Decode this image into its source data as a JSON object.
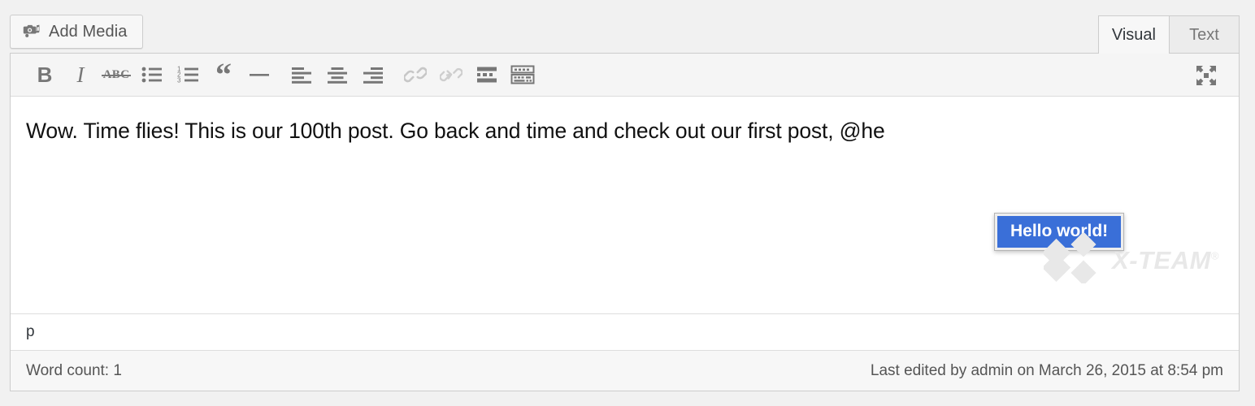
{
  "toolbar_top": {
    "add_media_label": "Add Media",
    "add_media_icon": "camera-music-icon",
    "tabs": [
      {
        "label": "Visual",
        "active": true
      },
      {
        "label": "Text",
        "active": false
      }
    ]
  },
  "format_toolbar": {
    "buttons": [
      {
        "name": "bold",
        "glyph": "B",
        "title": "Bold",
        "disabled": false
      },
      {
        "name": "italic",
        "glyph": "I",
        "title": "Italic",
        "disabled": false
      },
      {
        "name": "strikethrough",
        "glyph": "ABC",
        "title": "Strikethrough",
        "disabled": false
      },
      {
        "name": "bullet-list",
        "glyph": "",
        "title": "Bulleted list",
        "disabled": false
      },
      {
        "name": "numbered-list",
        "glyph": "",
        "title": "Numbered list",
        "disabled": false
      },
      {
        "name": "blockquote",
        "glyph": "“",
        "title": "Blockquote",
        "disabled": false
      },
      {
        "name": "horizontal-rule",
        "glyph": "—",
        "title": "Horizontal line",
        "disabled": false
      },
      {
        "name": "align-left",
        "glyph": "",
        "title": "Align left",
        "disabled": false
      },
      {
        "name": "align-center",
        "glyph": "",
        "title": "Align center",
        "disabled": false
      },
      {
        "name": "align-right",
        "glyph": "",
        "title": "Align right",
        "disabled": false
      },
      {
        "name": "insert-link",
        "glyph": "",
        "title": "Insert/edit link",
        "disabled": true
      },
      {
        "name": "remove-link",
        "glyph": "",
        "title": "Remove link",
        "disabled": true
      },
      {
        "name": "read-more",
        "glyph": "",
        "title": "Insert Read More tag",
        "disabled": false
      },
      {
        "name": "toolbar-toggle",
        "glyph": "",
        "title": "Toolbar Toggle",
        "disabled": false
      }
    ],
    "fullscreen": {
      "name": "distraction-free-mode",
      "title": "Distraction-free writing mode"
    }
  },
  "content": {
    "post_text": "Wow. Time flies! This is our 100th post. Go back and time and check out our first post, @he",
    "mention_suggestions": [
      {
        "label": "Hello world!",
        "selected": true
      }
    ],
    "watermark": {
      "text": "X-TEAM",
      "registered_mark": "®"
    }
  },
  "statusbar": {
    "element_path": "p"
  },
  "footer": {
    "word_count": "Word count: 1",
    "last_edited": "Last edited by admin on March 26, 2015 at 8:54 pm"
  },
  "colors": {
    "page_bg": "#f1f1f1",
    "toolbar_bg": "#f5f5f5",
    "editor_bg": "#ffffff",
    "border": "#cccccc",
    "icon_gray": "#777777",
    "suggestion_blue": "#3a6fd8",
    "watermark_gray": "#e8e8e8",
    "footer_bg": "#f7f7f7"
  }
}
